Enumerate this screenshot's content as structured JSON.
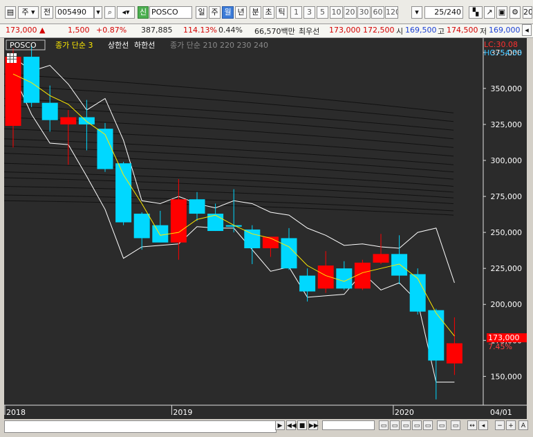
{
  "toolbar": {
    "period_type": "주",
    "prev_label": "전",
    "code": "005490",
    "sin_label": "신",
    "name": "POSCO",
    "day": "일",
    "week": "주",
    "month": "월",
    "year": "년",
    "minute": "분",
    "second": "초",
    "tick": "틱",
    "periods": [
      "1",
      "3",
      "5",
      "10",
      "20",
      "30",
      "60",
      "120"
    ],
    "count": "25/240",
    "edge": "20"
  },
  "quote": {
    "price": "173,000",
    "change": "1,500",
    "pct": "+0.87%",
    "volume": "387,885",
    "vol_ratio": "114.13%",
    "turnover": "0.44%",
    "amount": "66,570백만",
    "best_label": "최우선",
    "ask": "173,000",
    "bid": "172,500",
    "open_label": "시",
    "open": "169,500",
    "high_label": "고",
    "high": "174,500",
    "low_label": "저",
    "low": "169,000"
  },
  "legend": {
    "name": "POSCO",
    "ma": "종가 단순 3",
    "upper": "상한선",
    "lower": "하한선",
    "ma2": "종가 단순 210  220  230  240"
  },
  "readout": {
    "lc": "LC:30.08",
    "hc": "HC:-54.53"
  },
  "colors": {
    "up": "#ff0000",
    "down": "#00d8ff",
    "ma": "#ffeb00",
    "band": "#ffffff",
    "bg": "#2b2b2b"
  },
  "chart_data": {
    "type": "candlestick",
    "y_ticks": [
      "375,000",
      "350,000",
      "325,000",
      "300,000",
      "275,000",
      "250,000",
      "225,000",
      "200,000",
      "175,000",
      "150,000"
    ],
    "ylim": [
      130000,
      385000
    ],
    "x_ticks": [
      "2018",
      "2019",
      "2020"
    ],
    "right_corner_label": "04/01",
    "last_price_label": "173,000",
    "last_pct_label": "7.45%",
    "candles": [
      {
        "o": 324000,
        "h": 378000,
        "l": 309000,
        "c": 372000
      },
      {
        "o": 372000,
        "h": 380000,
        "l": 337000,
        "c": 340000
      },
      {
        "o": 340000,
        "h": 352000,
        "l": 320000,
        "c": 328000
      },
      {
        "o": 325000,
        "h": 335000,
        "l": 297000,
        "c": 330000
      },
      {
        "o": 330000,
        "h": 342000,
        "l": 307000,
        "c": 325000
      },
      {
        "o": 322000,
        "h": 326000,
        "l": 292000,
        "c": 294000
      },
      {
        "o": 298000,
        "h": 299000,
        "l": 255000,
        "c": 257000
      },
      {
        "o": 263000,
        "h": 264000,
        "l": 238000,
        "c": 246000
      },
      {
        "o": 255000,
        "h": 265000,
        "l": 246000,
        "c": 243000
      },
      {
        "o": 243000,
        "h": 287000,
        "l": 231000,
        "c": 273000
      },
      {
        "o": 273000,
        "h": 278000,
        "l": 258000,
        "c": 263000
      },
      {
        "o": 263000,
        "h": 270000,
        "l": 251000,
        "c": 251000
      },
      {
        "o": 255000,
        "h": 280000,
        "l": 250000,
        "c": 254000
      },
      {
        "o": 252000,
        "h": 255000,
        "l": 228000,
        "c": 239000
      },
      {
        "o": 239000,
        "h": 244000,
        "l": 233000,
        "c": 247000
      },
      {
        "o": 246000,
        "h": 253000,
        "l": 224000,
        "c": 225000
      },
      {
        "o": 220000,
        "h": 225000,
        "l": 202000,
        "c": 209000
      },
      {
        "o": 211000,
        "h": 237000,
        "l": 208000,
        "c": 227000
      },
      {
        "o": 225000,
        "h": 230000,
        "l": 210000,
        "c": 211000
      },
      {
        "o": 211000,
        "h": 231000,
        "l": 210000,
        "c": 229000
      },
      {
        "o": 229000,
        "h": 249000,
        "l": 228000,
        "c": 235000
      },
      {
        "o": 235000,
        "h": 248000,
        "l": 214000,
        "c": 220000
      },
      {
        "o": 221000,
        "h": 225000,
        "l": 193000,
        "c": 195000
      },
      {
        "o": 196000,
        "h": 197000,
        "l": 134000,
        "c": 161000
      },
      {
        "o": 159000,
        "h": 191000,
        "l": 151000,
        "c": 173000
      }
    ],
    "ma3": [
      360000,
      354000,
      345000,
      339000,
      327000,
      318000,
      290000,
      270000,
      248000,
      250000,
      259000,
      262000,
      255000,
      249000,
      246000,
      240000,
      227000,
      220000,
      216000,
      222000,
      225000,
      228000,
      218000,
      194000,
      178000
    ],
    "upper_band": [
      372000,
      362000,
      366000,
      353000,
      335000,
      343000,
      314000,
      272000,
      270000,
      275000,
      270000,
      267000,
      272000,
      270000,
      264000,
      262000,
      253000,
      248000,
      241000,
      242000,
      240000,
      239000,
      250000,
      253000,
      215000
    ],
    "lower_band": [
      360000,
      332000,
      312000,
      311000,
      289000,
      266000,
      232000,
      240000,
      241000,
      242000,
      254000,
      253000,
      253000,
      238000,
      223000,
      226000,
      205000,
      206000,
      207000,
      222000,
      210000,
      215000,
      202000,
      146000,
      146000
    ]
  }
}
